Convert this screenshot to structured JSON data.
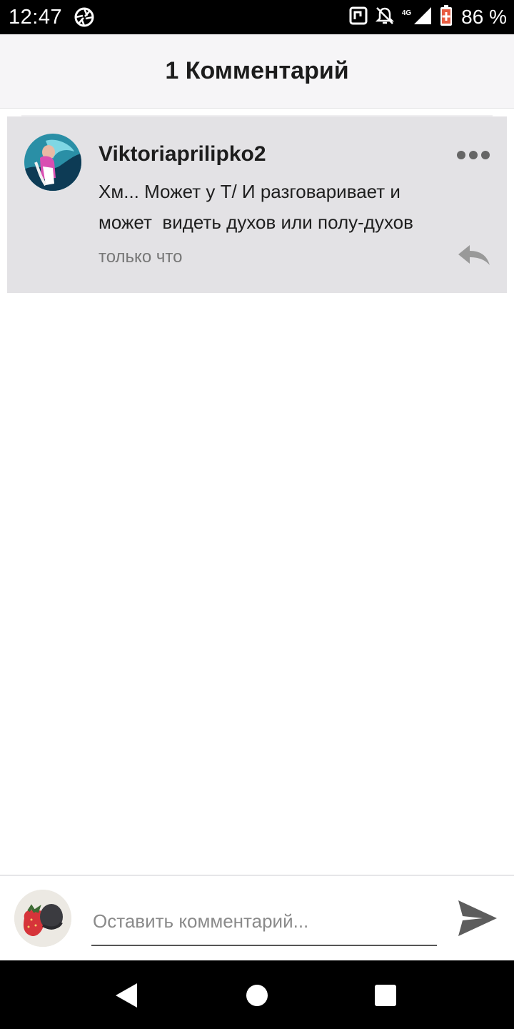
{
  "status_bar": {
    "time": "12:47",
    "network": "4G",
    "battery_percent": "86 %",
    "icons": [
      "aperture-icon",
      "nfc-icon",
      "bell-off-icon",
      "signal-icon",
      "battery-icon"
    ]
  },
  "header": {
    "title": "1 Комментарий"
  },
  "comments": [
    {
      "author": "Viktoriaprilipko2",
      "text": "Хм... Может у Т/ И разговаривает и\nможет  видеть духов или полу-духов",
      "time": "только что",
      "icons": [
        "avatar",
        "more-icon",
        "reply-icon"
      ]
    }
  ],
  "input": {
    "placeholder": "Оставить комментарий..."
  },
  "colors": {
    "header_bg": "#f6f5f7",
    "comment_bg": "#e3e2e5",
    "status_bar_bg": "#000000",
    "nav_bar_bg": "#000000"
  },
  "navigation": {
    "icons": [
      "back-icon",
      "home-icon",
      "recents-icon"
    ]
  }
}
